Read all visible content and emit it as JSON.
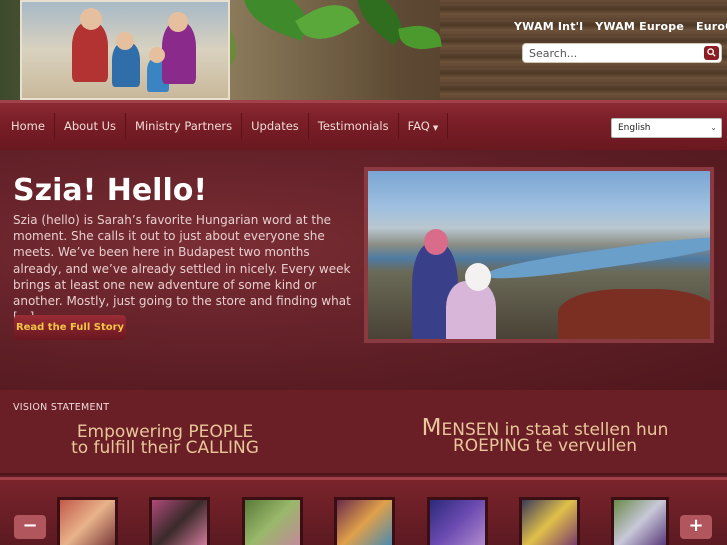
{
  "header": {
    "top_links": [
      "YWAM Int'l",
      "YWAM Europe",
      "EuroCom"
    ],
    "search": {
      "placeholder": "Search..."
    }
  },
  "nav": {
    "items": [
      {
        "label": "Home",
        "has_dropdown": false
      },
      {
        "label": "About Us",
        "has_dropdown": false
      },
      {
        "label": "Ministry Partners",
        "has_dropdown": false
      },
      {
        "label": "Updates",
        "has_dropdown": false
      },
      {
        "label": "Testimonials",
        "has_dropdown": false
      },
      {
        "label": "FAQ",
        "has_dropdown": true
      }
    ],
    "language": {
      "selected": "English"
    }
  },
  "feature": {
    "title": "Szia! Hello!",
    "excerpt": "Szia (hello) is Sarah’s favorite Hungarian word at the moment. She calls it out to just about everyone she meets. We’ve been here in Budapest two months already, and we’ve already settled in nicely. Every week brings at least one new adventure of some kind or another. Mostly, just going to the store and finding what […]",
    "button": "Read the Full Story"
  },
  "vision": {
    "label": "VISION STATEMENT",
    "english": {
      "line1": "Empowering PEOPLE",
      "line2": "to fulfill their CALLING"
    },
    "dutch": {
      "cap": "M",
      "line1_rest": "ENSEN in staat stellen hun",
      "line2": "ROEPING te vervullen"
    }
  },
  "gallery": {
    "prev_label": "−",
    "next_label": "+",
    "thumbnail_count": 7
  },
  "colors": {
    "brand_maroon": "#6a1e26",
    "nav": "#7a1e27",
    "button_text": "#f4c545",
    "vision_text": "#e9c79a"
  }
}
